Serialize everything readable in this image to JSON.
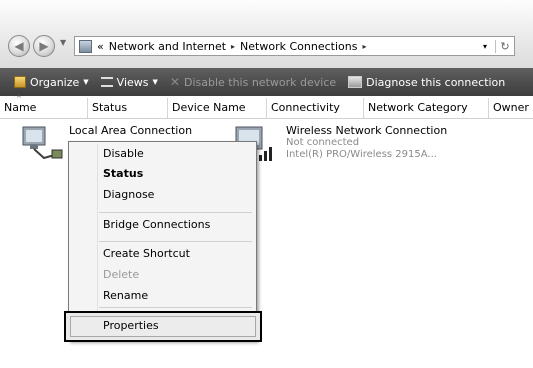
{
  "address_bar": {
    "chevron": "«",
    "crumbs": [
      "Network and Internet",
      "Network Connections"
    ],
    "separator": "▸",
    "dropdown_icon": "▾",
    "refresh_icon": "↻"
  },
  "toolbar": {
    "organize": "Organize",
    "views": "Views",
    "disable": "Disable this network device",
    "diagnose": "Diagnose this connection"
  },
  "columns": [
    "Name",
    "Status",
    "Device Name",
    "Connectivity",
    "Network Category",
    "Owner"
  ],
  "connections": [
    {
      "name": "Local Area Connection",
      "status": "",
      "device": ""
    },
    {
      "name": "Wireless Network Connection",
      "status": "Not connected",
      "device": "Intel(R) PRO/Wireless 2915A..."
    }
  ],
  "context_menu": {
    "items": [
      "Disable",
      "Status",
      "Diagnose",
      "Bridge Connections",
      "Create Shortcut",
      "Delete",
      "Rename",
      "Properties"
    ]
  }
}
